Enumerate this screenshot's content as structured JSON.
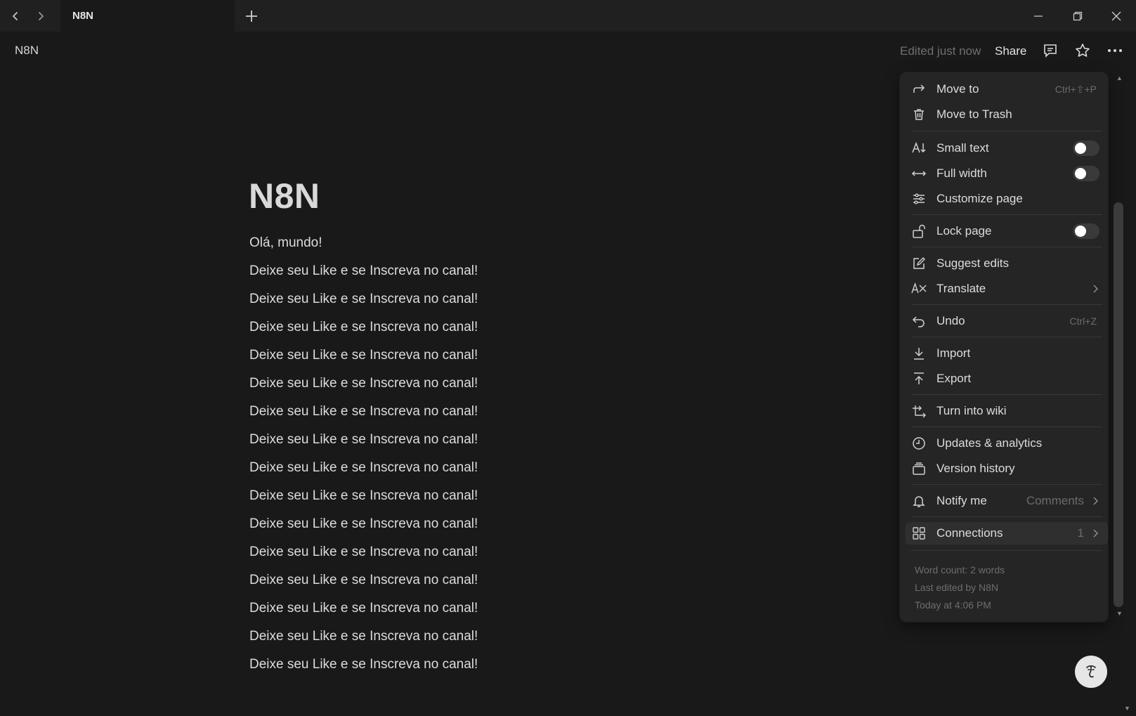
{
  "tabbar": {
    "tab_title": "N8N"
  },
  "header": {
    "breadcrumb": "N8N",
    "edited": "Edited just now",
    "share": "Share"
  },
  "page": {
    "title": "N8N",
    "lines": [
      "Olá, mundo!",
      "Deixe seu Like e se Inscreva no canal!",
      "Deixe seu Like e se Inscreva no canal!",
      "Deixe seu Like e se Inscreva no canal!",
      "Deixe seu Like e se Inscreva no canal!",
      "Deixe seu Like e se Inscreva no canal!",
      "Deixe seu Like e se Inscreva no canal!",
      "Deixe seu Like e se Inscreva no canal!",
      "Deixe seu Like e se Inscreva no canal!",
      "Deixe seu Like e se Inscreva no canal!",
      "Deixe seu Like e se Inscreva no canal!",
      "Deixe seu Like e se Inscreva no canal!",
      "Deixe seu Like e se Inscreva no canal!",
      "Deixe seu Like e se Inscreva no canal!",
      "Deixe seu Like e se Inscreva no canal!",
      "Deixe seu Like e se Inscreva no canal!"
    ]
  },
  "menu": {
    "move_to": {
      "label": "Move to",
      "shortcut": "Ctrl+⇧+P"
    },
    "move_to_trash": {
      "label": "Move to Trash"
    },
    "small_text": {
      "label": "Small text"
    },
    "full_width": {
      "label": "Full width"
    },
    "customize_page": {
      "label": "Customize page"
    },
    "lock_page": {
      "label": "Lock page"
    },
    "suggest_edits": {
      "label": "Suggest edits"
    },
    "translate": {
      "label": "Translate"
    },
    "undo": {
      "label": "Undo",
      "shortcut": "Ctrl+Z"
    },
    "import": {
      "label": "Import"
    },
    "export": {
      "label": "Export"
    },
    "turn_into_wiki": {
      "label": "Turn into wiki"
    },
    "updates_analytics": {
      "label": "Updates & analytics"
    },
    "version_history": {
      "label": "Version history"
    },
    "notify_me": {
      "label": "Notify me",
      "value": "Comments"
    },
    "connections": {
      "label": "Connections",
      "count": "1"
    },
    "footer": {
      "word_count": "Word count: 2 words",
      "last_edited_by": "Last edited by N8N",
      "last_edited_at": "Today at 4:06 PM"
    }
  }
}
